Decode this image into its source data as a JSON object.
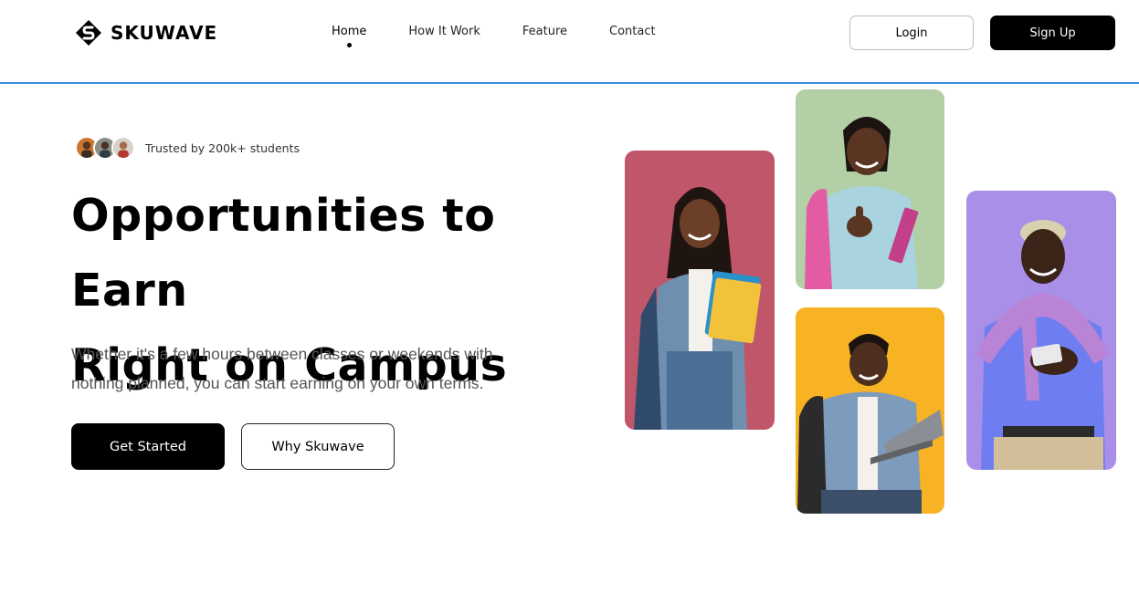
{
  "brand": {
    "name": "SKUWAVE",
    "logo_icon": "skuwave-logo-icon"
  },
  "nav": {
    "items": [
      {
        "label": "Home",
        "active": true
      },
      {
        "label": "How It Work",
        "active": false
      },
      {
        "label": "Feature",
        "active": false
      },
      {
        "label": "Contact",
        "active": false
      }
    ]
  },
  "auth": {
    "login_label": "Login",
    "signup_label": "Sign Up"
  },
  "hero": {
    "trust_text": "Trusted by 200k+ students",
    "title_line1": "Opportunities to Earn",
    "title_line2": "Right on Campus",
    "description": "Whether it's a few hours between classes or weekends with nothing planned, you can start earning on your own terms.",
    "primary_cta": "Get Started",
    "secondary_cta": "Why Skuwave"
  },
  "photos": [
    {
      "name": "student-with-books-photo",
      "bg": "#c0566a"
    },
    {
      "name": "student-thumbs-up-photo",
      "bg": "#b3cfa5"
    },
    {
      "name": "student-with-laptop-photo",
      "bg": "#f7b324"
    },
    {
      "name": "student-with-phone-photo",
      "bg": "#a98fe8"
    }
  ],
  "colors": {
    "accent_line": "#3b8fdc",
    "primary": "#000000"
  }
}
